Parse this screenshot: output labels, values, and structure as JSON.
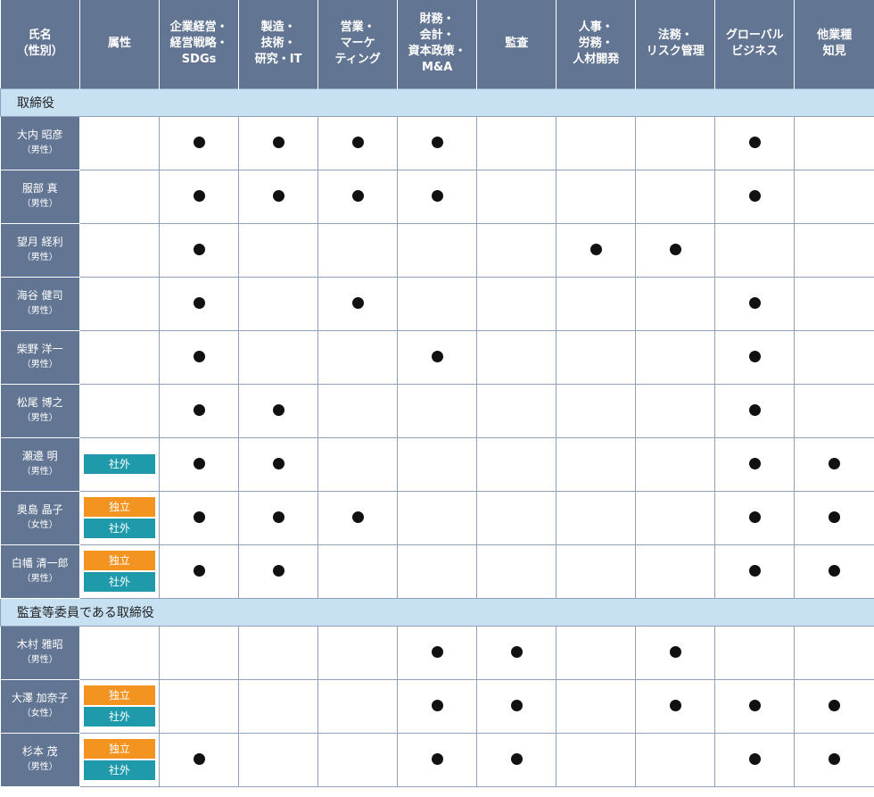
{
  "headers": {
    "name": "氏名\n（性別）",
    "attr": "属性",
    "skills": [
      "企業経営・\n経営戦略・\nSDGs",
      "製造・\n技術・\n研究・IT",
      "営業・\nマーケ\nティング",
      "財務・\n会計・\n資本政策・\nM&A",
      "監査",
      "人事・\n労務・\n人材開発",
      "法務・\nリスク管理",
      "グローバル\nビジネス",
      "他業種\n知見"
    ]
  },
  "sections": [
    {
      "title": "取締役",
      "members": [
        {
          "name": "大内 昭彦",
          "sex": "（男性）",
          "badges": [],
          "skills": [
            1,
            1,
            1,
            1,
            0,
            0,
            0,
            1,
            0
          ]
        },
        {
          "name": "服部 真",
          "sex": "（男性）",
          "badges": [],
          "skills": [
            1,
            1,
            1,
            1,
            0,
            0,
            0,
            1,
            0
          ]
        },
        {
          "name": "望月 経利",
          "sex": "（男性）",
          "badges": [],
          "skills": [
            1,
            0,
            0,
            0,
            0,
            1,
            1,
            0,
            0
          ]
        },
        {
          "name": "海谷 健司",
          "sex": "（男性）",
          "badges": [],
          "skills": [
            1,
            0,
            1,
            0,
            0,
            0,
            0,
            1,
            0
          ]
        },
        {
          "name": "柴野 洋一",
          "sex": "（男性）",
          "badges": [],
          "skills": [
            1,
            0,
            0,
            1,
            0,
            0,
            0,
            1,
            0
          ]
        },
        {
          "name": "松尾 博之",
          "sex": "（男性）",
          "badges": [],
          "skills": [
            1,
            1,
            0,
            0,
            0,
            0,
            0,
            1,
            0
          ]
        },
        {
          "name": "瀬邊 明",
          "sex": "（男性）",
          "badges": [
            "社外"
          ],
          "skills": [
            1,
            1,
            0,
            0,
            0,
            0,
            0,
            1,
            1
          ]
        },
        {
          "name": "奥島 晶子",
          "sex": "（女性）",
          "badges": [
            "独立",
            "社外"
          ],
          "skills": [
            1,
            1,
            1,
            0,
            0,
            0,
            0,
            1,
            1
          ]
        },
        {
          "name": "白幡 清一郎",
          "sex": "（男性）",
          "badges": [
            "独立",
            "社外"
          ],
          "skills": [
            1,
            1,
            0,
            0,
            0,
            0,
            0,
            1,
            1
          ]
        }
      ]
    },
    {
      "title": "監査等委員である取締役",
      "members": [
        {
          "name": "木村 雅昭",
          "sex": "（男性）",
          "badges": [],
          "skills": [
            0,
            0,
            0,
            1,
            1,
            0,
            1,
            0,
            0
          ]
        },
        {
          "name": "大澤 加奈子",
          "sex": "（女性）",
          "badges": [
            "独立",
            "社外"
          ],
          "skills": [
            0,
            0,
            0,
            1,
            1,
            0,
            1,
            1,
            1
          ]
        },
        {
          "name": "杉本 茂",
          "sex": "（男性）",
          "badges": [
            "独立",
            "社外"
          ],
          "skills": [
            1,
            0,
            0,
            1,
            1,
            0,
            0,
            1,
            1
          ]
        }
      ]
    }
  ]
}
